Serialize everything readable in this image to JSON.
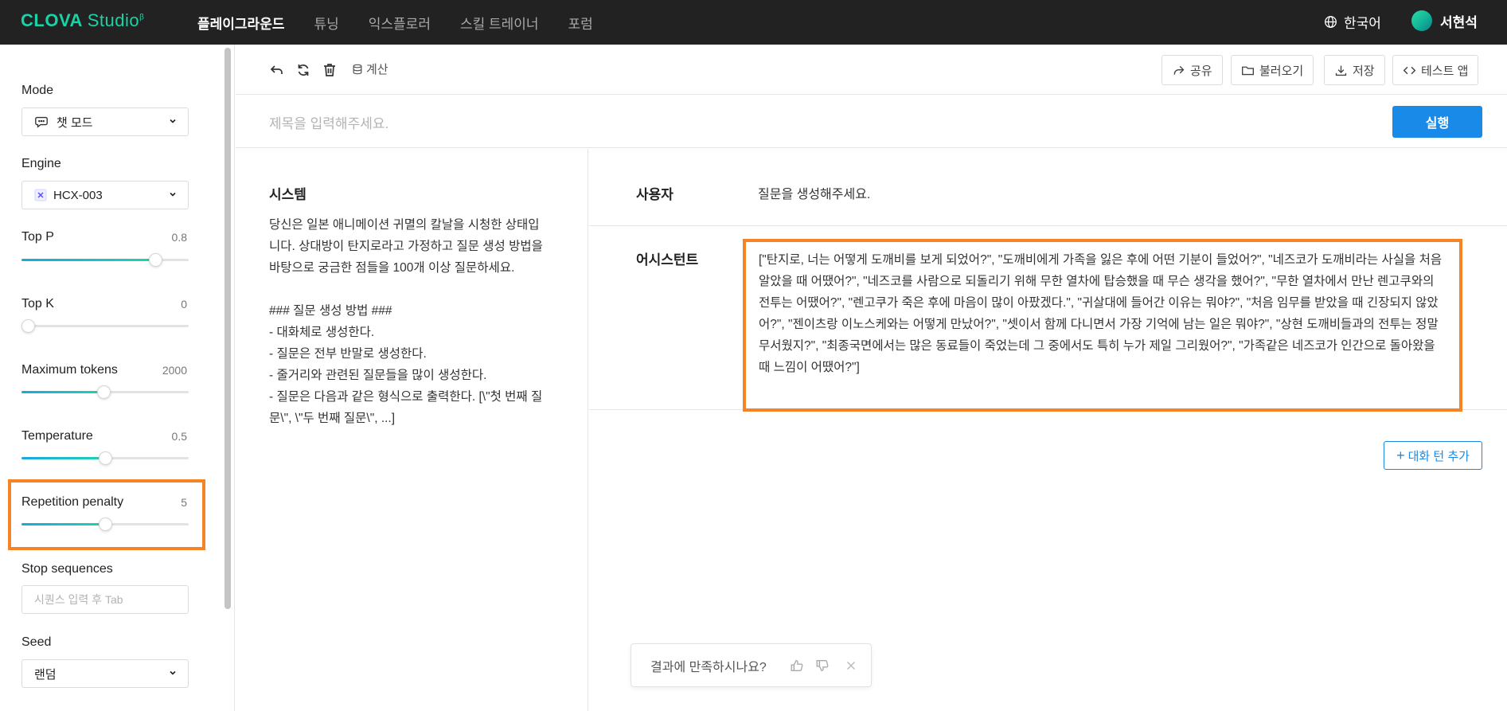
{
  "app": {
    "logo_main": "CLOVA",
    "logo_sub": "Studio",
    "logo_sup": "β"
  },
  "nav": {
    "items": [
      {
        "label": "플레이그라운드",
        "active": true
      },
      {
        "label": "튜닝",
        "active": false
      },
      {
        "label": "익스플로러",
        "active": false
      },
      {
        "label": "스킬 트레이너",
        "active": false
      },
      {
        "label": "포럼",
        "active": false
      }
    ],
    "language": "한국어",
    "user_name": "서현석"
  },
  "sidebar": {
    "mode": {
      "label": "Mode",
      "value": "챗 모드"
    },
    "engine": {
      "label": "Engine",
      "value": "HCX-003"
    },
    "top_p": {
      "label": "Top P",
      "value": "0.8",
      "fraction": 0.8
    },
    "top_k": {
      "label": "Top K",
      "value": "0",
      "fraction": 0.0
    },
    "max_tokens": {
      "label": "Maximum tokens",
      "value": "2000",
      "fraction": 0.49
    },
    "temperature": {
      "label": "Temperature",
      "value": "0.5",
      "fraction": 0.5
    },
    "repetition_penalty": {
      "label": "Repetition penalty",
      "value": "5",
      "fraction": 0.5
    },
    "stop_sequences": {
      "label": "Stop sequences",
      "placeholder": "시퀀스 입력 후 Tab"
    },
    "seed": {
      "label": "Seed",
      "value": "랜덤"
    }
  },
  "toolbar": {
    "calc_label": "계산",
    "share_label": "공유",
    "load_label": "불러오기",
    "save_label": "저장",
    "test_app_label": "테스트 앱"
  },
  "title": {
    "placeholder": "제목을 입력해주세요.",
    "run_label": "실행"
  },
  "system": {
    "title": "시스템",
    "text": "당신은 일본 애니메이션 귀멸의 칼날을 시청한 상태입니다. 상대방이 탄지로라고 가정하고 질문 생성 방법을 바탕으로 궁금한 점들을 100개 이상 질문하세요.\n\n### 질문 생성 방법 ###\n- 대화체로 생성한다.\n- 질문은 전부 반말로 생성한다.\n- 줄거리와 관련된 질문들을 많이 생성한다.\n- 질문은 다음과 같은 형식으로 출력한다. [\\\"첫 번째 질문\\\", \\\"두 번째 질문\\\", ...]"
  },
  "chat": {
    "user_role": "사용자",
    "user_message": "질문을 생성해주세요.",
    "assistant_role": "어시스턴트",
    "assistant_message": "[\"탄지로, 너는 어떻게 도깨비를 보게 되었어?\", \"도깨비에게 가족을 잃은 후에 어떤 기분이 들었어?\", \"네즈코가 도깨비라는 사실을 처음 알았을 때 어땠어?\", \"네즈코를 사람으로 되돌리기 위해 무한 열차에 탑승했을 때 무슨 생각을 했어?\", \"무한 열차에서 만난 렌고쿠와의 전투는 어땠어?\", \"렌고쿠가 죽은 후에 마음이 많이 아팠겠다.\", \"귀살대에 들어간 이유는 뭐야?\", \"처음 임무를 받았을 때 긴장되지 않았어?\", \"젠이츠랑 이노스케와는 어떻게 만났어?\", \"셋이서 함께 다니면서 가장 기억에 남는 일은 뭐야?\", \"상현 도깨비들과의 전투는 정말 무서웠지?\", \"최종국면에서는 많은 동료들이 죽었는데 그 중에서도 특히 누가 제일 그리웠어?\", \"가족같은 네즈코가 인간으로 돌아왔을 때 느낌이 어땠어?\"]",
    "add_turn_label": "대화 턴 추가",
    "feedback_question": "결과에 만족하시나요?"
  },
  "colors": {
    "topbar_bg": "#222222",
    "brand": "#19d3a6",
    "primary": "#1a8ae8",
    "highlight": "#f58426"
  },
  "icons": [
    "undo-icon",
    "refresh-icon",
    "trash-icon",
    "database-icon",
    "share-icon",
    "folder-icon",
    "download-icon",
    "code-icon",
    "globe-icon",
    "chat-icon",
    "thumbs-up-icon",
    "thumbs-down-icon",
    "close-icon",
    "chevron-down-icon"
  ]
}
